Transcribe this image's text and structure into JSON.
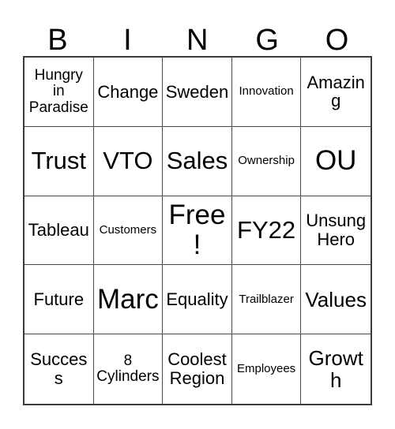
{
  "card": {
    "type": "bingo-card",
    "columns": 5,
    "rows": 5,
    "header": {
      "letters": [
        "B",
        "I",
        "N",
        "G",
        "O"
      ]
    },
    "free_space": "Free!",
    "colors": {
      "background": "#ffffff",
      "text": "#000000",
      "outer_border": "#3b3b3b",
      "grid_line": "#4a4a4a"
    },
    "cells": [
      {
        "text": "Hungry in Paradise",
        "lines": [
          "Hungry",
          "in",
          "Paradise"
        ],
        "size": "sm"
      },
      {
        "text": "Change",
        "lines": [
          "Change"
        ],
        "size": "md"
      },
      {
        "text": "Sweden",
        "lines": [
          "Sweden"
        ],
        "size": "md"
      },
      {
        "text": "Innovation",
        "lines": [
          "Innovation"
        ],
        "size": "xs"
      },
      {
        "text": "Amazing",
        "lines": [
          "Amazing"
        ],
        "size": "md"
      },
      {
        "text": "Trust",
        "lines": [
          "Trust"
        ],
        "size": "xl"
      },
      {
        "text": "VTO",
        "lines": [
          "VTO"
        ],
        "size": "xl"
      },
      {
        "text": "Sales",
        "lines": [
          "Sales"
        ],
        "size": "xl"
      },
      {
        "text": "Ownership",
        "lines": [
          "Ownership"
        ],
        "size": "xs"
      },
      {
        "text": "OU",
        "lines": [
          "OU"
        ],
        "size": "xxl"
      },
      {
        "text": "Tableau",
        "lines": [
          "Tableau"
        ],
        "size": "md"
      },
      {
        "text": "Customers",
        "lines": [
          "Customers"
        ],
        "size": "xs"
      },
      {
        "text": "Free!",
        "lines": [
          "Free!"
        ],
        "size": "xxl"
      },
      {
        "text": "FY22",
        "lines": [
          "FY22"
        ],
        "size": "xl"
      },
      {
        "text": "Unsung Hero",
        "lines": [
          "Unsung",
          "Hero"
        ],
        "size": "md"
      },
      {
        "text": "Future",
        "lines": [
          "Future"
        ],
        "size": "md"
      },
      {
        "text": "Marc",
        "lines": [
          "Marc"
        ],
        "size": "xxl"
      },
      {
        "text": "Equality",
        "lines": [
          "Equality"
        ],
        "size": "md"
      },
      {
        "text": "Trailblazer",
        "lines": [
          "Trailblazer"
        ],
        "size": "xs"
      },
      {
        "text": "Values",
        "lines": [
          "Values"
        ],
        "size": "lg"
      },
      {
        "text": "Success",
        "lines": [
          "Success"
        ],
        "size": "md"
      },
      {
        "text": "8 Cylinders",
        "lines": [
          "8",
          "Cylinders"
        ],
        "size": "sm"
      },
      {
        "text": "Coolest Region",
        "lines": [
          "Coolest",
          "Region"
        ],
        "size": "md"
      },
      {
        "text": "Employees",
        "lines": [
          "Employees"
        ],
        "size": "xs"
      },
      {
        "text": "Growth",
        "lines": [
          "Growth"
        ],
        "size": "lg"
      }
    ]
  }
}
